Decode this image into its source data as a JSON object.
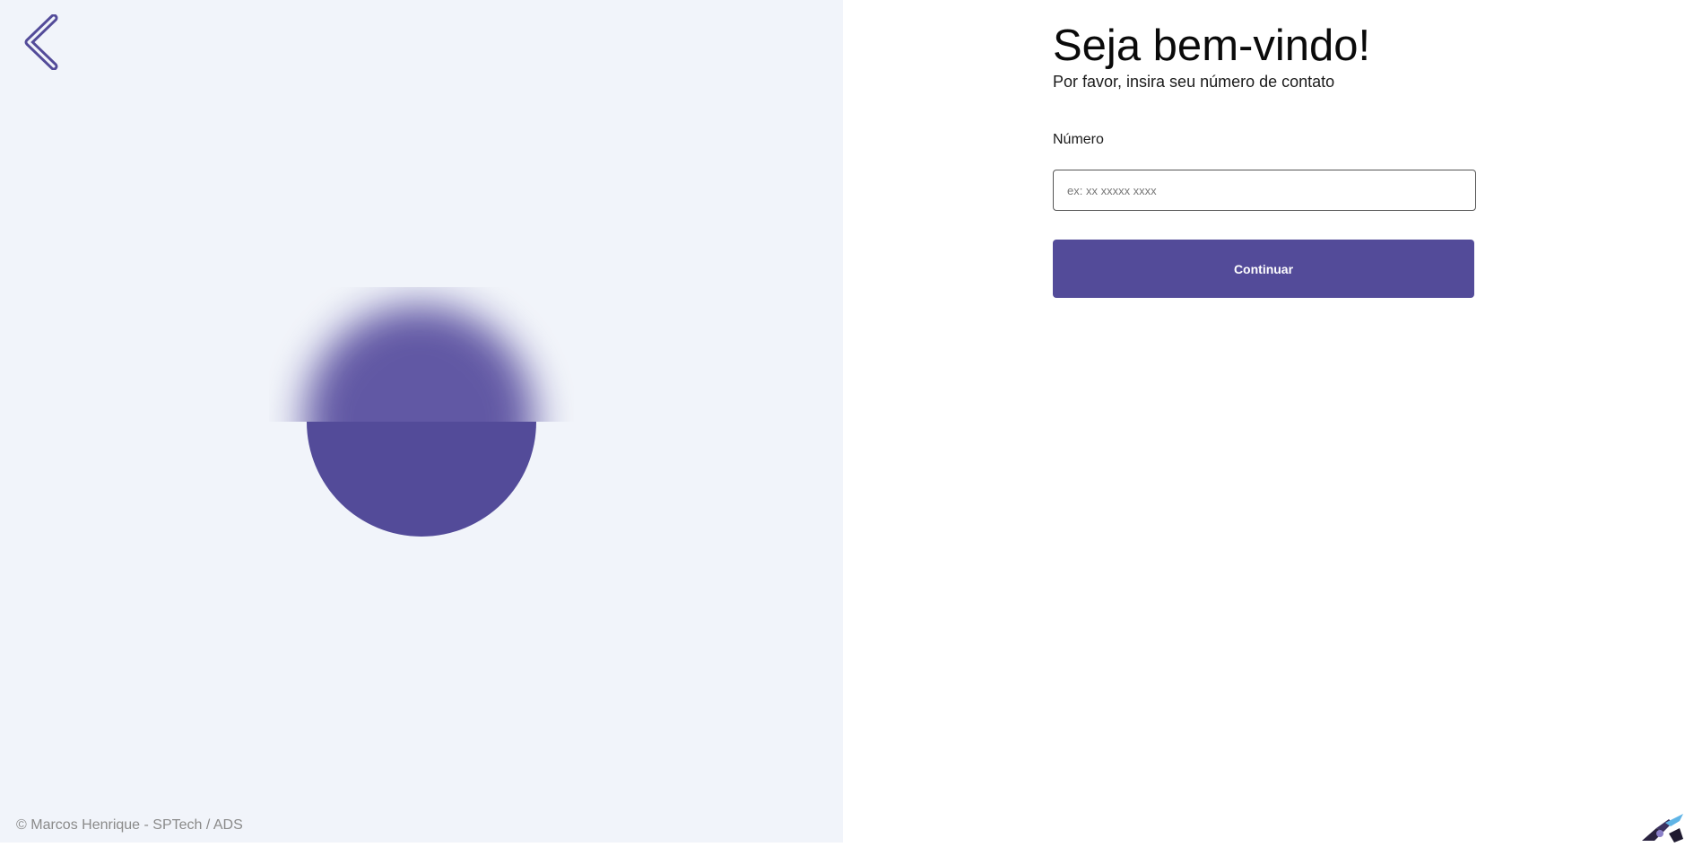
{
  "left_panel": {
    "back_icon": "chevron-left-icon",
    "footer": "© Marcos Henrique - SPTech / ADS"
  },
  "form": {
    "title": "Seja bem-vindo!",
    "subtitle": "Por favor, insira seu número de contato",
    "number_label": "Número",
    "number_value": "",
    "number_placeholder": "ex: xx xxxxx xxxx",
    "continue_label": "Continuar"
  },
  "colors": {
    "accent": "#534b99",
    "left_background": "#f1f4fa",
    "right_background": "#ffffff"
  }
}
